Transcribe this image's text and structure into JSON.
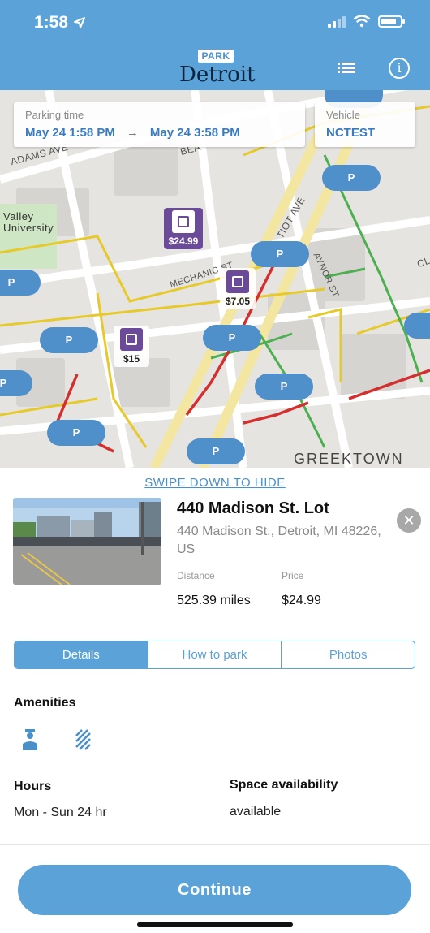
{
  "status": {
    "time": "1:58"
  },
  "header": {
    "logo_park": "PARK",
    "logo_city": "Detroit",
    "list_icon": "list-icon",
    "info_icon": "info-icon"
  },
  "map": {
    "parking_time": {
      "label": "Parking time",
      "start": "May 24 1:58 PM",
      "arrow": "→",
      "end": "May 24 3:58 PM"
    },
    "vehicle": {
      "label": "Vehicle",
      "value": "NCTEST"
    },
    "streets": [
      "ADAMS AVE",
      "BEA",
      "MECHANIC ST",
      "TIOT AVE",
      "AYNOR ST",
      "CL",
      "Valley",
      "University"
    ],
    "area_label": "GREEKTOWN",
    "pin_label": "P",
    "prices": [
      "$24.99",
      "$7.05",
      "$15"
    ]
  },
  "sheet": {
    "swipe_hint": "SWIPE DOWN TO HIDE",
    "lot_name": "440 Madison St. Lot",
    "lot_address": "440 Madison St., Detroit, MI 48226, US",
    "distance_label": "Distance",
    "distance_value": "525.39 miles",
    "price_label": "Price",
    "price_value": "$24.99",
    "tabs": [
      "Details",
      "How to park",
      "Photos"
    ],
    "amenities_title": "Amenities",
    "amenity_icons": [
      "attendant-icon",
      "covered-parking-icon"
    ],
    "hours_title": "Hours",
    "hours_value": "Mon - Sun 24 hr",
    "availability_title": "Space availability",
    "availability_value": "available",
    "continue_label": "Continue"
  },
  "colors": {
    "accent": "#5aa2d8",
    "price_pin": "#6c4a9a",
    "map_pin": "#4f8fca"
  }
}
